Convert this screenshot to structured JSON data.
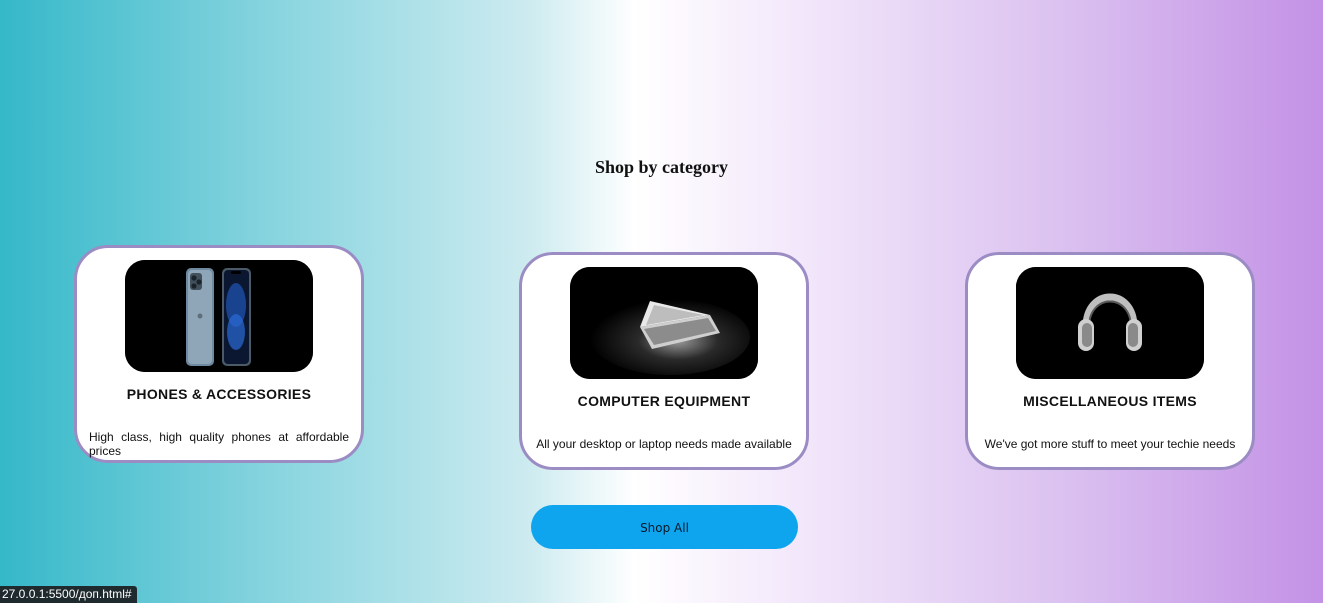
{
  "section": {
    "title": "Shop by category"
  },
  "cards": [
    {
      "title": "PHONES & ACCESSORIES",
      "description": "High class, high quality phones at affordable prices",
      "image_icon": "phones-image"
    },
    {
      "title": "COMPUTER EQUIPMENT",
      "description": "All your desktop or laptop needs made available",
      "image_icon": "laptop-image"
    },
    {
      "title": "MISCELLANEOUS ITEMS",
      "description": "We've got more stuff to meet your techie needs",
      "image_icon": "headphones-image"
    }
  ],
  "shop_all": {
    "label": "Shop All"
  },
  "status_bar": {
    "url": "27.0.0.1:5500/доп.html#"
  },
  "colors": {
    "background_gradient": [
      "#35b8c9",
      "#ffffff",
      "#c391e6"
    ],
    "card_border": "#9b8cc4",
    "button": "#0ea5ee"
  }
}
